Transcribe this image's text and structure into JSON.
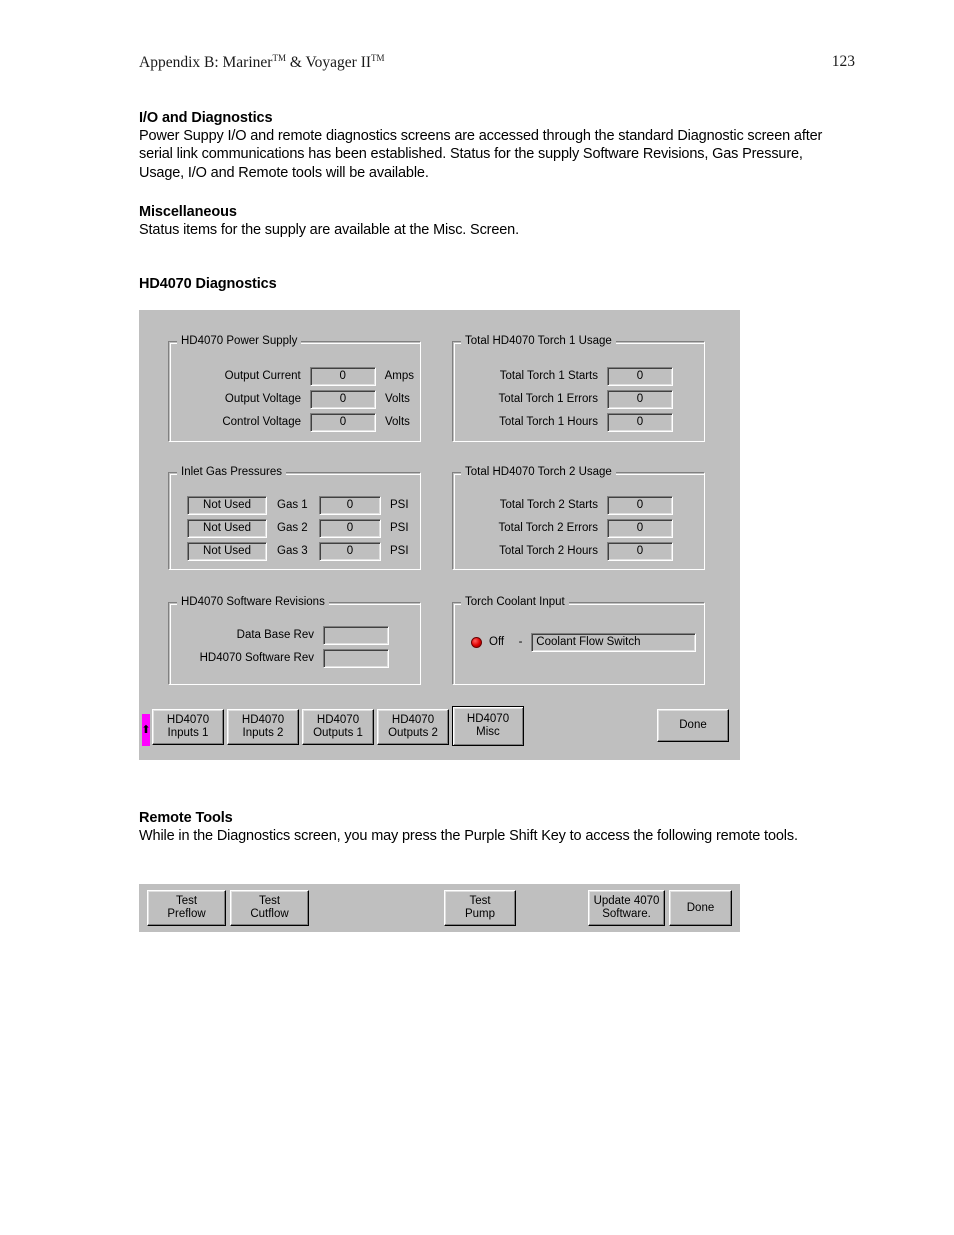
{
  "page": {
    "header_title": "Appendix B: Mariner™ & Voyager II™",
    "header_title_main": "Appendix B: Mariner",
    "header_tm1": "TM",
    "header_mid": " & Voyager II",
    "header_tm2": "TM",
    "page_number": "123"
  },
  "sections": [
    {
      "heading": "I/O and Diagnostics",
      "body": "Power Suppy I/O and remote diagnostics screens are accessed through the standard Diagnostic screen after serial link communications has been established.  Status for the supply Software Revisions, Gas Pressure, Usage, I/O and Remote tools will be available."
    },
    {
      "heading": "Miscellaneous",
      "body": "Status items for the supply are available at the Misc. Screen."
    },
    {
      "heading": "HD4070 Diagnostics",
      "body": ""
    },
    {
      "heading": "Remote Tools",
      "body": "While in the Diagnostics screen, you may press the Purple Shift Key to access the following remote tools."
    }
  ],
  "dialog": {
    "power_supply": {
      "title": "HD4070 Power Supply",
      "rows": [
        {
          "label": "Output Current",
          "value": "0",
          "unit": "Amps"
        },
        {
          "label": "Output Voltage",
          "value": "0",
          "unit": "Volts"
        },
        {
          "label": "Control Voltage",
          "value": "0",
          "unit": "Volts"
        }
      ]
    },
    "torch1": {
      "title": "Total HD4070 Torch 1 Usage",
      "rows": [
        {
          "label": "Total Torch 1 Starts",
          "value": "0"
        },
        {
          "label": "Total Torch 1 Errors",
          "value": "0"
        },
        {
          "label": "Total Torch 1 Hours",
          "value": "0"
        }
      ]
    },
    "gas": {
      "title": "Inlet Gas Pressures",
      "rows": [
        {
          "status": "Not Used",
          "label": "Gas 1",
          "value": "0",
          "unit": "PSI"
        },
        {
          "status": "Not Used",
          "label": "Gas 2",
          "value": "0",
          "unit": "PSI"
        },
        {
          "status": "Not Used",
          "label": "Gas 3",
          "value": "0",
          "unit": "PSI"
        }
      ]
    },
    "torch2": {
      "title": "Total HD4070 Torch 2 Usage",
      "rows": [
        {
          "label": "Total Torch 2 Starts",
          "value": "0"
        },
        {
          "label": "Total Torch 2 Errors",
          "value": "0"
        },
        {
          "label": "Total Torch 2 Hours",
          "value": "0"
        }
      ]
    },
    "software": {
      "title": "HD4070 Software Revisions",
      "rows": [
        {
          "label": "Data Base Rev",
          "value": ""
        },
        {
          "label": "HD4070 Software Rev",
          "value": ""
        }
      ]
    },
    "coolant": {
      "title": "Torch Coolant Input",
      "state_label": "Off",
      "separator": "-",
      "input_name": "Coolant Flow Switch",
      "led_color": "#e00000"
    },
    "nav_buttons": [
      {
        "line1": "HD4070",
        "line2": "Inputs 1",
        "focused": false
      },
      {
        "line1": "HD4070",
        "line2": "Inputs 2",
        "focused": false
      },
      {
        "line1": "HD4070",
        "line2": "Outputs 1",
        "focused": false
      },
      {
        "line1": "HD4070",
        "line2": "Outputs 2",
        "focused": false
      },
      {
        "line1": "HD4070",
        "line2": "Misc",
        "focused": true
      }
    ],
    "done_button": "Done",
    "shift_key": {
      "glyph": "⬆",
      "color": "#ff00ff"
    }
  },
  "toolbar": {
    "buttons": [
      {
        "line1": "Test",
        "line2": "Preflow"
      },
      {
        "line1": "Test",
        "line2": "Cutflow"
      },
      {
        "line1": "Test",
        "line2": "Pump"
      },
      {
        "line1": "Update 4070",
        "line2": "Software."
      },
      {
        "line1": "Done",
        "line2": ""
      }
    ]
  }
}
